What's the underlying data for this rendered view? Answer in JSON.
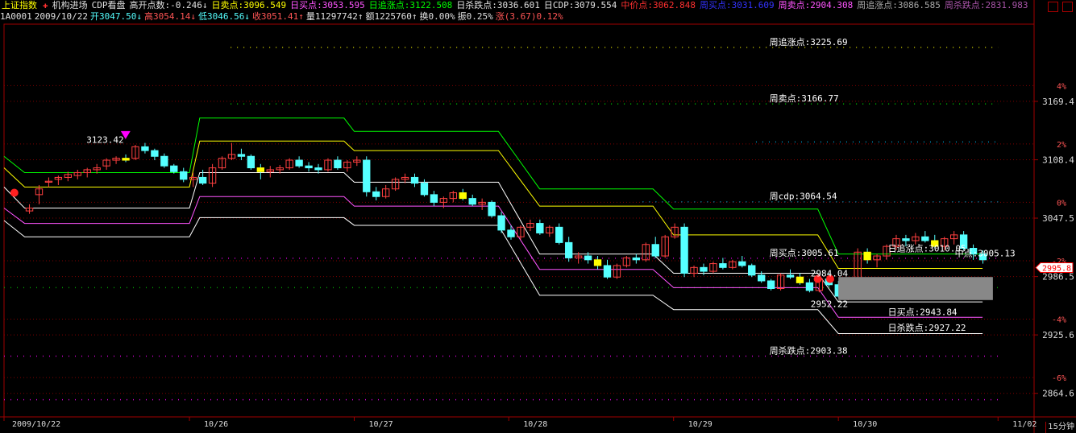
{
  "header": {
    "title": "上证指数",
    "items": [
      {
        "text": "机构进场",
        "color": "#e0e0e0"
      },
      {
        "text": "CDP看盘",
        "color": "#e0e0e0"
      },
      {
        "text": "高开点数:-0.246↓",
        "color": "#e0e0e0"
      },
      {
        "text": "日卖点:3096.549",
        "color": "#ffff00"
      },
      {
        "text": "日买点:3053.595",
        "color": "#ff55ff"
      },
      {
        "text": "日追涨点:3122.508",
        "color": "#00ff00"
      },
      {
        "text": "日杀跌点:3036.601",
        "color": "#e0e0e0"
      },
      {
        "text": "日CDP:3079.554",
        "color": "#e0e0e0"
      },
      {
        "text": "中价点:3062.848",
        "color": "#ff3030"
      },
      {
        "text": "周买点:3031.609",
        "color": "#3333ff"
      },
      {
        "text": "周卖点:2904.308",
        "color": "#ff55ff"
      },
      {
        "text": "周追涨点:3086.585",
        "color": "#aaaaaa"
      },
      {
        "text": "周杀跌点:2831.983",
        "color": "#aa55aa"
      }
    ],
    "row2": [
      {
        "text": "1A0001",
        "color": "#e0e0e0"
      },
      {
        "text": "2009/10/22",
        "color": "#e0e0e0"
      },
      {
        "text": "开3047.50↓",
        "color": "#55ffff"
      },
      {
        "text": "高3054.14↓",
        "color": "#ff5555"
      },
      {
        "text": "低3046.56↓",
        "color": "#55ffff"
      },
      {
        "text": "收3051.41↑",
        "color": "#ff5555"
      },
      {
        "text": "量11297742↑",
        "color": "#e0e0e0"
      },
      {
        "text": "额1225760↑",
        "color": "#e0e0e0"
      },
      {
        "text": "换0.00%",
        "color": "#e0e0e0"
      },
      {
        "text": "振0.25%",
        "color": "#e0e0e0"
      },
      {
        "text": "涨(3.67)0.12%",
        "color": "#ff5555"
      }
    ]
  },
  "period_label": "15分钟",
  "chart_data": {
    "type": "candlestick",
    "ylim": [
      2840,
      3250
    ],
    "price_ticks": [
      "3169.4",
      "3108.4",
      "3047.5",
      "2986.5",
      "2925.6",
      "2864.6"
    ],
    "pct_ticks": [
      "4%",
      "2%",
      "0%",
      "-2%",
      "-4%",
      "-6%"
    ],
    "x_ticks": [
      "2009/10/22",
      "10/26",
      "10/27",
      "10/28",
      "10/29",
      "10/30",
      "11/02"
    ],
    "last_price": "2995.8",
    "annotations": [
      {
        "text": "周追涨点:3225.69",
        "x": 0.79,
        "y": 3225.69,
        "color": "#ffffff"
      },
      {
        "text": "周卖点:3166.77",
        "x": 0.79,
        "y": 3166.77,
        "color": "#ffffff"
      },
      {
        "text": "周cdp:3064.54",
        "x": 0.79,
        "y": 3064.54,
        "color": "#ffffff"
      },
      {
        "text": "周买点:3005.61",
        "x": 0.79,
        "y": 3005.61,
        "color": "#ffffff"
      },
      {
        "text": "周杀跌点:2903.38",
        "x": 0.79,
        "y": 2903.38,
        "color": "#ffffff"
      },
      {
        "text": "日追涨点:3010.05",
        "x": 0.905,
        "y": 3010.05,
        "color": "#ffffff"
      },
      {
        "text": "中点:3005.13",
        "x": 0.97,
        "y": 3005.13,
        "color": "#ffffff"
      },
      {
        "text": "日买点:2943.84",
        "x": 0.905,
        "y": 2943.84,
        "color": "#ffffff"
      },
      {
        "text": "日杀跌点:2927.22",
        "x": 0.905,
        "y": 2927.22,
        "color": "#ffffff"
      },
      {
        "text": "3123.42",
        "x": 0.127,
        "y": 3123.42,
        "color": "#ffffff"
      },
      {
        "text": "2952.22",
        "x": 0.83,
        "y": 2952.22,
        "color": "#ffffff"
      },
      {
        "text": "2984.04",
        "x": 0.83,
        "y": 2984.04,
        "color": "#ffffff"
      }
    ],
    "dotted_levels": [
      {
        "name": "周追涨点",
        "value": 3225.69,
        "color": "#c8c800",
        "x_start": 0.22
      },
      {
        "name": "周卖点",
        "value": 3166.77,
        "color": "#00c000",
        "x_start": 0.22
      },
      {
        "name": "周cdp",
        "value": 3064.54,
        "color": "#0090c0",
        "x_start": 0.62
      },
      {
        "name": "周买点",
        "value": 3005.61,
        "color": "#d000d0",
        "x_start": 0.18
      },
      {
        "name": "周杀跌点",
        "value": 2903.38,
        "color": "#d000d0",
        "x_start": 0.0
      },
      {
        "name": "lower",
        "value": 2858.0,
        "color": "#d000d0",
        "x_start": 0.0
      },
      {
        "name": "周cdp-old",
        "value": 3127.0,
        "color": "#0090c0",
        "x_start": 0.73
      },
      {
        "name": "周买点-old",
        "value": 2975.0,
        "color": "#00a000",
        "x_start": 0.0
      }
    ],
    "step_lines": [
      {
        "name": "日追涨点",
        "color": "#00ff00",
        "values": [
          [
            0.0,
            3112
          ],
          [
            0.02,
            3095
          ],
          [
            0.18,
            3095
          ],
          [
            0.19,
            3152
          ],
          [
            0.33,
            3152
          ],
          [
            0.34,
            3138
          ],
          [
            0.48,
            3138
          ],
          [
            0.52,
            3078
          ],
          [
            0.63,
            3078
          ],
          [
            0.65,
            3057
          ],
          [
            0.79,
            3057
          ],
          [
            0.81,
            3010
          ],
          [
            0.95,
            3010
          ]
        ]
      },
      {
        "name": "日卖点",
        "color": "#ffff00",
        "values": [
          [
            0.0,
            3100
          ],
          [
            0.02,
            3080
          ],
          [
            0.18,
            3080
          ],
          [
            0.19,
            3128
          ],
          [
            0.33,
            3128
          ],
          [
            0.34,
            3118
          ],
          [
            0.48,
            3118
          ],
          [
            0.52,
            3060
          ],
          [
            0.63,
            3060
          ],
          [
            0.65,
            3030
          ],
          [
            0.79,
            3030
          ],
          [
            0.81,
            2995
          ],
          [
            0.95,
            2995
          ]
        ]
      },
      {
        "name": "日CDP",
        "color": "#ffffff",
        "values": [
          [
            0.0,
            3080
          ],
          [
            0.02,
            3058
          ],
          [
            0.18,
            3058
          ],
          [
            0.19,
            3095
          ],
          [
            0.33,
            3095
          ],
          [
            0.34,
            3085
          ],
          [
            0.48,
            3085
          ],
          [
            0.52,
            3010
          ],
          [
            0.63,
            3010
          ],
          [
            0.65,
            2990
          ],
          [
            0.79,
            2990
          ],
          [
            0.81,
            2960
          ],
          [
            0.95,
            2960
          ]
        ]
      },
      {
        "name": "日买点",
        "color": "#ff55ff",
        "values": [
          [
            0.0,
            3058
          ],
          [
            0.02,
            3042
          ],
          [
            0.18,
            3042
          ],
          [
            0.19,
            3070
          ],
          [
            0.33,
            3070
          ],
          [
            0.34,
            3060
          ],
          [
            0.48,
            3060
          ],
          [
            0.52,
            2994
          ],
          [
            0.63,
            2994
          ],
          [
            0.65,
            2975
          ],
          [
            0.79,
            2975
          ],
          [
            0.81,
            2944
          ],
          [
            0.95,
            2944
          ]
        ]
      },
      {
        "name": "日杀跌点",
        "color": "#ffffff",
        "values": [
          [
            0.0,
            3045
          ],
          [
            0.02,
            3028
          ],
          [
            0.18,
            3028
          ],
          [
            0.19,
            3048
          ],
          [
            0.33,
            3048
          ],
          [
            0.34,
            3040
          ],
          [
            0.48,
            3040
          ],
          [
            0.52,
            2967
          ],
          [
            0.63,
            2967
          ],
          [
            0.65,
            2952
          ],
          [
            0.79,
            2952
          ],
          [
            0.81,
            2927
          ],
          [
            0.95,
            2927
          ]
        ]
      }
    ],
    "candles": [
      [
        3055,
        3062,
        3052,
        3058
      ],
      [
        3072,
        3082,
        3062,
        3078
      ],
      [
        3085,
        3090,
        3080,
        3086
      ],
      [
        3088,
        3092,
        3082,
        3090
      ],
      [
        3090,
        3096,
        3086,
        3093
      ],
      [
        3092,
        3098,
        3088,
        3095
      ],
      [
        3095,
        3100,
        3090,
        3098
      ],
      [
        3098,
        3104,
        3094,
        3100
      ],
      [
        3102,
        3110,
        3098,
        3108
      ],
      [
        3108,
        3112,
        3104,
        3110
      ],
      [
        3110,
        3114,
        3106,
        3108
      ],
      [
        3110,
        3124,
        3108,
        3122
      ],
      [
        3122,
        3126,
        3115,
        3118
      ],
      [
        3118,
        3120,
        3108,
        3112
      ],
      [
        3112,
        3115,
        3100,
        3102
      ],
      [
        3102,
        3104,
        3094,
        3096
      ],
      [
        3096,
        3100,
        3085,
        3088
      ],
      [
        3088,
        3095,
        3080,
        3090
      ],
      [
        3090,
        3098,
        3082,
        3084
      ],
      [
        3084,
        3104,
        3080,
        3100
      ],
      [
        3100,
        3112,
        3098,
        3110
      ],
      [
        3110,
        3126,
        3108,
        3114
      ],
      [
        3114,
        3120,
        3108,
        3112
      ],
      [
        3112,
        3114,
        3098,
        3100
      ],
      [
        3100,
        3104,
        3088,
        3096
      ],
      [
        3096,
        3102,
        3090,
        3098
      ],
      [
        3098,
        3103,
        3094,
        3100
      ],
      [
        3100,
        3110,
        3098,
        3108
      ],
      [
        3108,
        3112,
        3100,
        3102
      ],
      [
        3102,
        3106,
        3096,
        3100
      ],
      [
        3100,
        3104,
        3094,
        3098
      ],
      [
        3098,
        3110,
        3096,
        3108
      ],
      [
        3108,
        3112,
        3098,
        3100
      ],
      [
        3100,
        3108,
        3096,
        3106
      ],
      [
        3106,
        3112,
        3102,
        3108
      ],
      [
        3108,
        3112,
        3070,
        3075
      ],
      [
        3075,
        3080,
        3066,
        3070
      ],
      [
        3070,
        3082,
        3068,
        3078
      ],
      [
        3078,
        3090,
        3076,
        3088
      ],
      [
        3088,
        3094,
        3084,
        3090
      ],
      [
        3090,
        3094,
        3080,
        3084
      ],
      [
        3084,
        3088,
        3070,
        3072
      ],
      [
        3072,
        3076,
        3060,
        3064
      ],
      [
        3064,
        3070,
        3058,
        3068
      ],
      [
        3068,
        3076,
        3064,
        3074
      ],
      [
        3074,
        3078,
        3066,
        3068
      ],
      [
        3068,
        3072,
        3060,
        3062
      ],
      [
        3062,
        3068,
        3056,
        3064
      ],
      [
        3064,
        3066,
        3048,
        3050
      ],
      [
        3050,
        3054,
        3032,
        3035
      ],
      [
        3035,
        3040,
        3025,
        3028
      ],
      [
        3028,
        3040,
        3025,
        3038
      ],
      [
        3038,
        3046,
        3034,
        3042
      ],
      [
        3042,
        3046,
        3030,
        3032
      ],
      [
        3032,
        3040,
        3028,
        3038
      ],
      [
        3038,
        3042,
        3020,
        3022
      ],
      [
        3022,
        3028,
        3002,
        3006
      ],
      [
        3006,
        3012,
        3000,
        3008
      ],
      [
        3008,
        3012,
        3000,
        3004
      ],
      [
        3004,
        3008,
        2994,
        2998
      ],
      [
        2998,
        3004,
        2984,
        2986
      ],
      [
        2986,
        3000,
        2984,
        2998
      ],
      [
        2998,
        3008,
        2996,
        3006
      ],
      [
        3006,
        3010,
        3000,
        3004
      ],
      [
        3004,
        3022,
        3002,
        3020
      ],
      [
        3020,
        3028,
        3006,
        3008
      ],
      [
        3008,
        3030,
        3006,
        3028
      ],
      [
        3028,
        3042,
        3026,
        3038
      ],
      [
        3038,
        3042,
        2986,
        2990
      ],
      [
        2990,
        2998,
        2986,
        2996
      ],
      [
        2996,
        3000,
        2988,
        2992
      ],
      [
        2992,
        3002,
        2990,
        3000
      ],
      [
        3000,
        3006,
        2994,
        2996
      ],
      [
        2996,
        3004,
        2994,
        3002
      ],
      [
        3002,
        3008,
        2996,
        2998
      ],
      [
        2998,
        3000,
        2986,
        2988
      ],
      [
        2988,
        2992,
        2980,
        2982
      ],
      [
        2982,
        2984,
        2972,
        2974
      ],
      [
        2974,
        2990,
        2972,
        2988
      ],
      [
        2988,
        2994,
        2984,
        2986
      ],
      [
        2986,
        2990,
        2978,
        2980
      ],
      [
        2980,
        2984,
        2970,
        2972
      ],
      [
        2972,
        2986,
        2970,
        2984
      ],
      [
        2984,
        2990,
        2976,
        2978
      ],
      [
        2978,
        2982,
        2964,
        2966
      ],
      [
        2966,
        2980,
        2962,
        2976
      ],
      [
        2976,
        3016,
        2974,
        3012
      ],
      [
        3012,
        3016,
        3000,
        3004
      ],
      [
        3004,
        3010,
        2996,
        3008
      ],
      [
        3008,
        3020,
        3004,
        3018
      ],
      [
        3018,
        3030,
        3014,
        3026
      ],
      [
        3026,
        3030,
        3018,
        3024
      ],
      [
        3024,
        3032,
        3020,
        3028
      ],
      [
        3028,
        3034,
        3022,
        3024
      ],
      [
        3024,
        3030,
        3016,
        3018
      ],
      [
        3018,
        3028,
        3014,
        3026
      ],
      [
        3026,
        3034,
        3020,
        3030
      ],
      [
        3030,
        3034,
        3014,
        3016
      ],
      [
        3016,
        3020,
        3004,
        3010
      ],
      [
        3010,
        3014,
        3000,
        3004
      ]
    ],
    "markers": [
      {
        "type": "triangle-down",
        "x": 0.118,
        "y": 3130,
        "color": "#ff00ff"
      },
      {
        "type": "dot",
        "x": 0.01,
        "y": 3074,
        "color": "#ff2020"
      },
      {
        "type": "dot",
        "x": 0.79,
        "y": 2984,
        "color": "#ff2020"
      },
      {
        "type": "dot",
        "x": 0.802,
        "y": 2984,
        "color": "#ff2020"
      }
    ],
    "grey_box": {
      "x0": 0.81,
      "x1": 0.96,
      "y0": 2986,
      "y1": 2962
    }
  }
}
